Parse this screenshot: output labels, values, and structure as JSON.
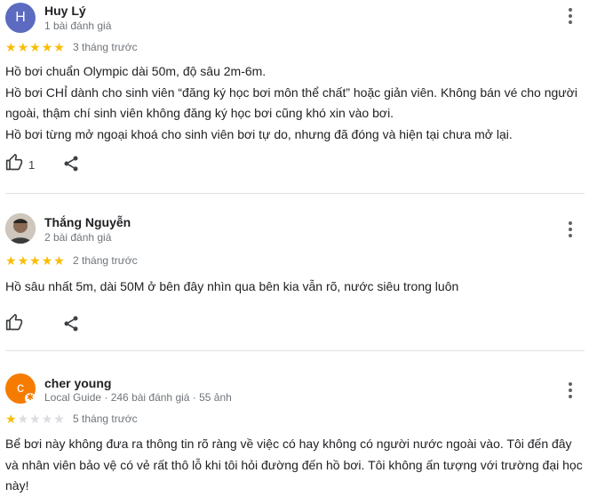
{
  "reviews": [
    {
      "avatar_letter": "H",
      "avatar_color": "#5c6bc0",
      "name": "Huy Lý",
      "meta": "1 bài đánh giá",
      "rating": 5,
      "time": "3 tháng trước",
      "paragraphs": [
        "Hồ bơi chuẩn Olympic dài 50m, độ sâu 2m-6m.",
        "Hồ bơi CHỈ dành cho sinh viên “đăng ký học bơi môn thể chất” hoặc giản viên. Không bán vé cho người ngoài, thậm chí sinh viên không đăng ký học bơi cũng khó xin vào bơi.",
        "Hồ bơi từng mở ngoại khoá cho sinh viên bơi tự do, nhưng đã đóng và hiện tại chưa mở lại."
      ],
      "likes": "1"
    },
    {
      "avatar_letter": "",
      "avatar_color": "#8d7a6a",
      "name": "Thắng Nguyễn",
      "meta": "2 bài đánh giá",
      "rating": 5,
      "time": "2 tháng trước",
      "paragraphs": [
        "Hồ sâu nhất 5m, dài 50M ở bên đây nhìn qua bên kia vẫn rõ, nước siêu trong luôn"
      ],
      "likes": ""
    },
    {
      "avatar_letter": "c",
      "avatar_color": "#f57c00",
      "name": "cher young",
      "meta": "Local Guide · 246 bài đánh giá · 55 ảnh",
      "rating": 1,
      "time": "5 tháng trước",
      "paragraphs": [
        "Bể bơi này không đưa ra thông tin rõ ràng về việc có hay không có người nước ngoài vào. Tôi đến đây và nhân viên bảo vệ có vẻ rất thô lỗ khi tôi hỏi đường đến hồ bơi. Tôi không ấn tượng với trường đại học này!"
      ],
      "likes": ""
    }
  ]
}
